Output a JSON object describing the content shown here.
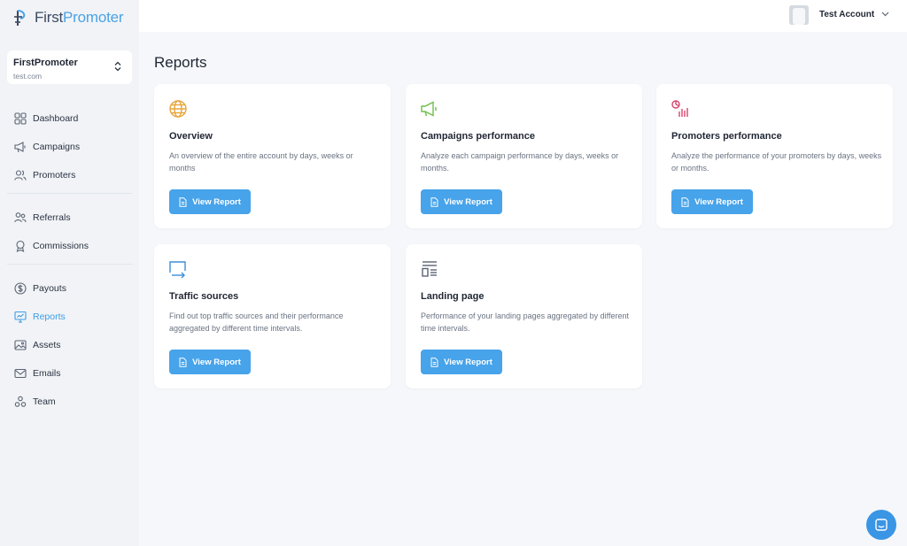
{
  "brand": {
    "first": "First",
    "promoter": "Promoter"
  },
  "account": {
    "name": "FirstPromoter",
    "domain": "test.com"
  },
  "user": {
    "name": "Test Account"
  },
  "nav": {
    "dashboard": "Dashboard",
    "campaigns": "Campaigns",
    "promoters": "Promoters",
    "referrals": "Referrals",
    "commissions": "Commissions",
    "payouts": "Payouts",
    "reports": "Reports",
    "assets": "Assets",
    "emails": "Emails",
    "team": "Team",
    "active": "reports"
  },
  "page": {
    "title": "Reports"
  },
  "cards": [
    {
      "title": "Overview",
      "description": "An overview of the entire account by days, weeks or months",
      "button": "View Report",
      "icon": "globe-icon",
      "color": "#e8a53a"
    },
    {
      "title": "Campaigns performance",
      "description": "Analyze each campaign performance by days, weeks or months.",
      "button": "View Report",
      "icon": "megaphone-icon",
      "color": "#6fbf4a"
    },
    {
      "title": "Promoters performance",
      "description": "Analyze the performance of your promoters by days, weeks or months.",
      "button": "View Report",
      "icon": "analytics-icon",
      "color": "#d9446b"
    },
    {
      "title": "Traffic sources",
      "description": "Find out top traffic sources and their performance aggregated by different time intervals.",
      "button": "View Report",
      "icon": "traffic-icon",
      "color": "#3a8fd8"
    },
    {
      "title": "Landing page",
      "description": "Performance of your landing pages aggregated by different time intervals.",
      "button": "View Report",
      "icon": "layout-icon",
      "color": "#5b6474"
    }
  ],
  "colors": {
    "accent": "#47a3ea",
    "active_nav": "#3a9ee6",
    "sidebar_bg": "#f1f3f6",
    "page_bg": "#f5f7fa"
  }
}
